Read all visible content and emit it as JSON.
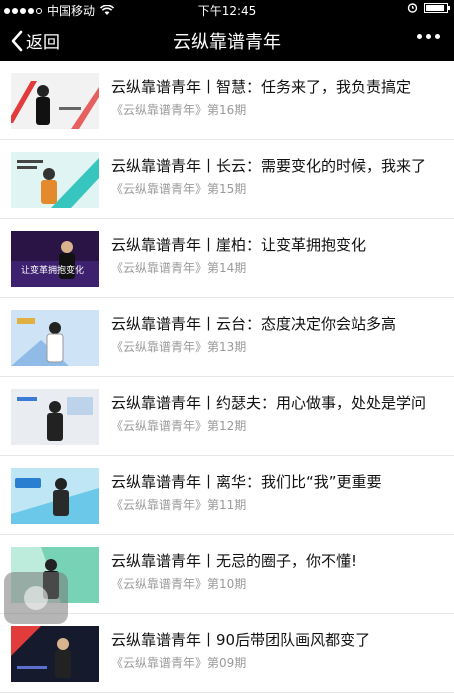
{
  "status_bar": {
    "carrier": "中国移动",
    "time": "下午12:45",
    "battery_level": 0.9
  },
  "nav": {
    "back_label": "返回",
    "title": "云纵靠谱青年"
  },
  "articles": [
    {
      "title": "云纵靠谱青年丨智慧：任务来了，我负责搞定",
      "issue": "《云纵靠谱青年》第16期",
      "thumb_text": "",
      "thumb_style": "red"
    },
    {
      "title": "云纵靠谱青年丨长云：需要变化的时候，我来了",
      "issue": "《云纵靠谱青年》第15期",
      "thumb_text": "",
      "thumb_style": "teal"
    },
    {
      "title": "云纵靠谱青年丨崖柏：让变革拥抱变化",
      "issue": "《云纵靠谱青年》第14期",
      "thumb_text": "让变革拥抱变化",
      "thumb_style": "purple"
    },
    {
      "title": "云纵靠谱青年丨云台：态度决定你会站多高",
      "issue": "《云纵靠谱青年》第13期",
      "thumb_text": "",
      "thumb_style": "blue"
    },
    {
      "title": "云纵靠谱青年丨约瑟夫：用心做事，处处是学问",
      "issue": "《云纵靠谱青年》第12期",
      "thumb_text": "",
      "thumb_style": "grey"
    },
    {
      "title": "云纵靠谱青年丨离华：我们比“我”更重要",
      "issue": "《云纵靠谱青年》第11期",
      "thumb_text": "",
      "thumb_style": "sky"
    },
    {
      "title": "云纵靠谱青年丨无忌的圈子，你不懂!",
      "issue": "《云纵靠谱青年》第10期",
      "thumb_text": "",
      "thumb_style": "mint"
    },
    {
      "title": "云纵靠谱青年丨90后带团队画风都变了",
      "issue": "《云纵靠谱青年》第09期",
      "thumb_text": "",
      "thumb_style": "dark"
    }
  ],
  "colors": {
    "bar_bg": "#000000",
    "title_text": "#111111",
    "issue_text": "#9a9a9a",
    "divider": "#e6e6e6"
  }
}
